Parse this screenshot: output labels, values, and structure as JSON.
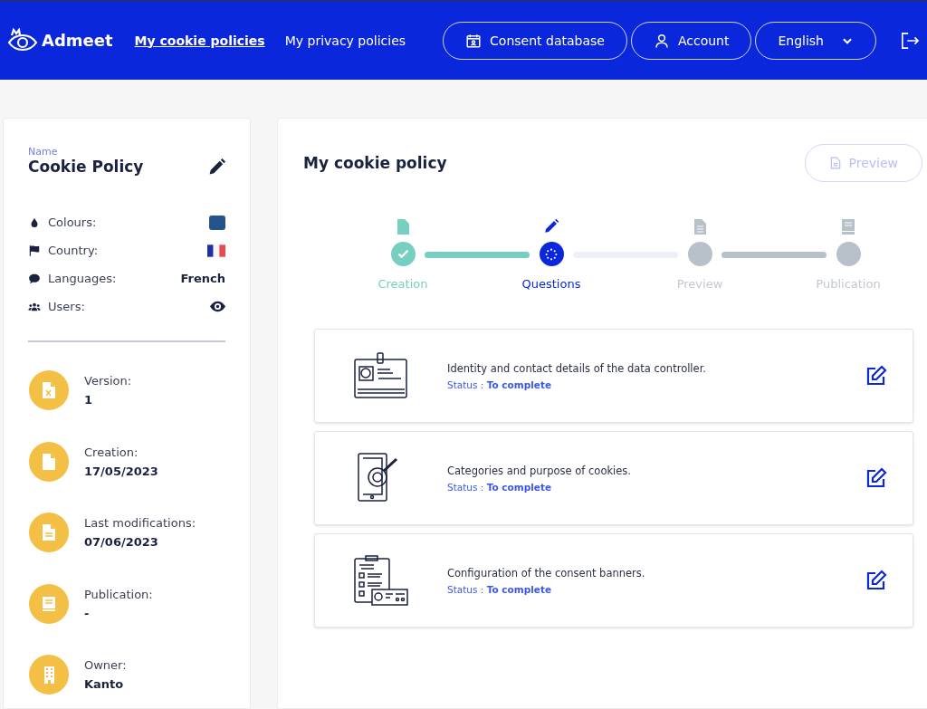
{
  "header": {
    "logo": "Admeet",
    "nav": [
      {
        "label": "My cookie policies",
        "selected": true
      },
      {
        "label": "My privacy policies",
        "selected": false
      }
    ],
    "buttons": [
      {
        "kind": "database",
        "label": "Consent database"
      },
      {
        "kind": "account",
        "label": "Account"
      },
      {
        "kind": "language",
        "label": "English"
      }
    ]
  },
  "sidebar": {
    "name_label": "Name",
    "name": "Cookie Policy",
    "details": [
      {
        "kind": "color",
        "label": "Colours:",
        "color": "#23548a"
      },
      {
        "kind": "flag",
        "label": "Country:"
      },
      {
        "kind": "text",
        "label": "Languages:",
        "value": "French"
      },
      {
        "kind": "eye",
        "label": "Users:"
      }
    ],
    "meta": [
      {
        "kind": "version",
        "label": "Version:",
        "value": "1"
      },
      {
        "kind": "creation",
        "label": "Creation:",
        "value": "17/05/2023"
      },
      {
        "kind": "modification",
        "label": "Last modifications:",
        "value": "07/06/2023"
      },
      {
        "kind": "publication",
        "label": "Publication:",
        "value": "-"
      },
      {
        "kind": "owner",
        "label": "Owner:",
        "value": "Kanto"
      }
    ]
  },
  "main": {
    "title": "My cookie policy",
    "preview_button": {
      "label": "Preview",
      "disabled": true
    },
    "steps": [
      {
        "kind": "file",
        "label": "Creation",
        "completed": true,
        "selected": false
      },
      {
        "kind": "pencil",
        "label": "Questions",
        "completed": false,
        "selected": true
      },
      {
        "kind": "document",
        "label": "Preview",
        "completed": false,
        "selected": false
      },
      {
        "kind": "book",
        "label": "Publication",
        "completed": false,
        "selected": false
      }
    ],
    "questions": [
      {
        "kind": "id-card",
        "text": "Identity and contact details of the data controller.",
        "status": "Status : **To complete**"
      },
      {
        "kind": "phone",
        "text": "Categories and purpose of cookies.",
        "status": "Status : **To complete**"
      },
      {
        "kind": "checklist",
        "text": "Configuration of the consent banners.",
        "status": "Status : **To complete**"
      }
    ]
  }
}
